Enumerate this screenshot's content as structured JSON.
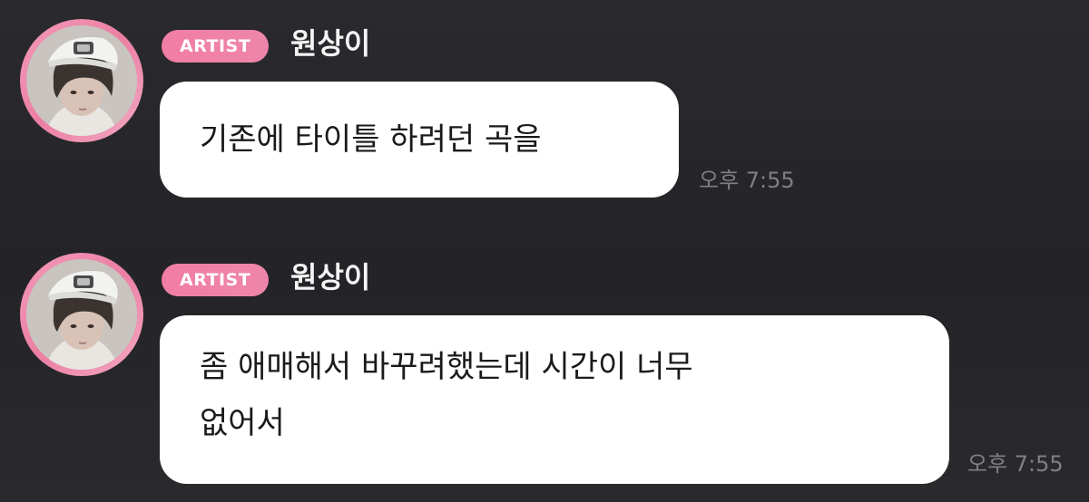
{
  "messages": [
    {
      "badge": "ARTIST",
      "sender": "원상이",
      "avatar": "profile-photo",
      "text": "기존에 타이틀 하려던 곡을",
      "time": "오후 7:55"
    },
    {
      "badge": "ARTIST",
      "sender": "원상이",
      "avatar": "profile-photo",
      "text": "좀 애매해서 바꾸려했는데 시간이 너무\n없어서",
      "time": "오후 7:55"
    }
  ],
  "colors": {
    "background": "#262629",
    "badge": "#f17da4",
    "avatar_ring": "#ec7fa3",
    "bubble": "#ffffff",
    "timestamp": "#7f7f84"
  }
}
